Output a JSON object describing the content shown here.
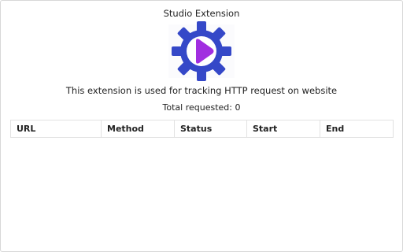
{
  "app": {
    "title": "Studio Extension",
    "logo_icon": "gear-play-icon",
    "colors": {
      "gear": "#3548c8",
      "play": "#a12ee0"
    }
  },
  "description": "This extension is used for tracking HTTP request on website",
  "total": {
    "text": "Total requested: 0"
  },
  "table": {
    "columns": [
      "URL",
      "Method",
      "Status",
      "Start",
      "End"
    ],
    "rows": []
  }
}
